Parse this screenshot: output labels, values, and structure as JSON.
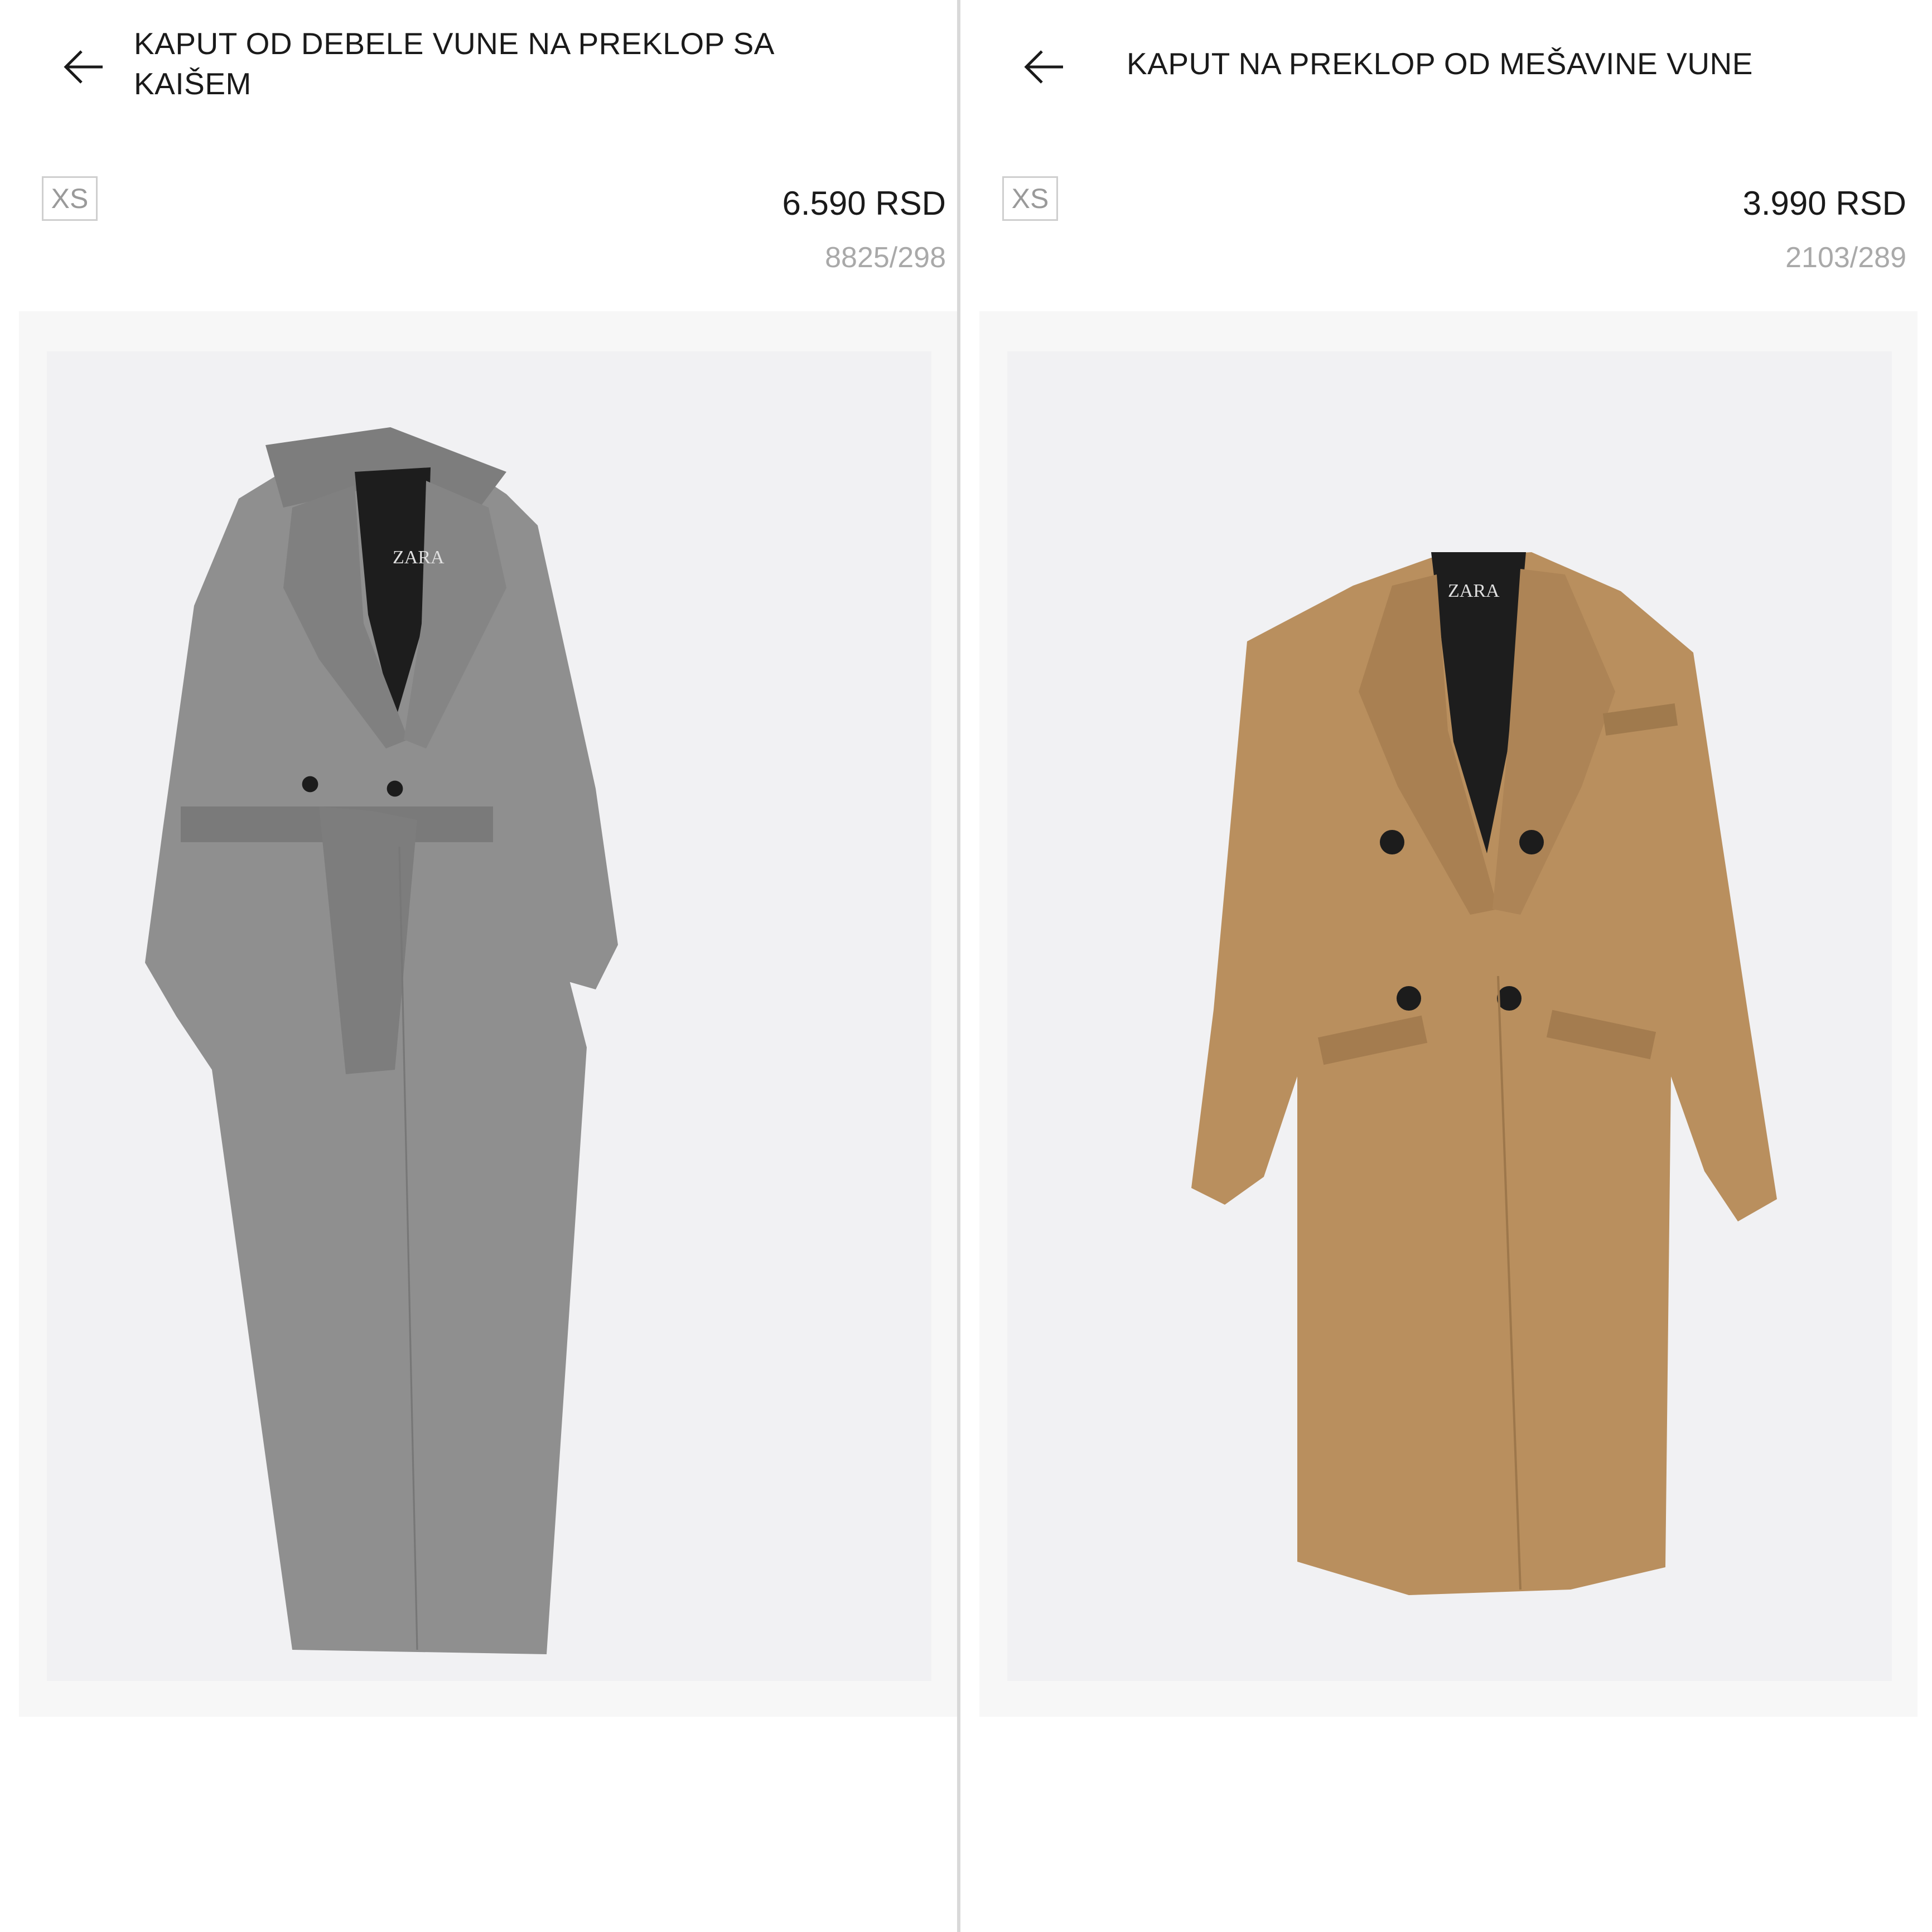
{
  "products": [
    {
      "title": "KAPUT OD DEBELE VUNE NA PREKLOP SA KAIŠEM",
      "size": "XS",
      "price": "6.590 RSD",
      "reference": "8825/298",
      "image_icon": "grey-belted-wool-coat-image",
      "color": "#8f8f8f"
    },
    {
      "title": "KAPUT NA PREKLOP OD MEŠAVINE VUNE",
      "size": "XS",
      "price": "3.990 RSD",
      "reference": "2103/289",
      "image_icon": "camel-double-breasted-coat-image",
      "color": "#b98f5e"
    }
  ],
  "labels": {
    "brand": "ZARA"
  }
}
